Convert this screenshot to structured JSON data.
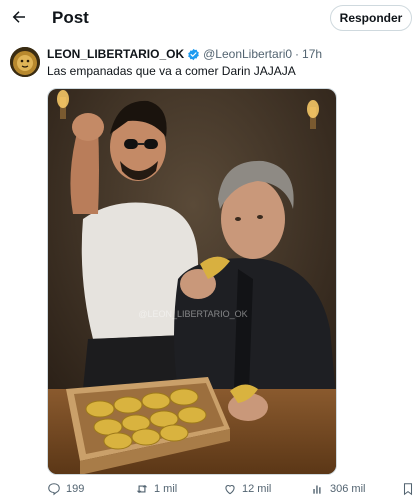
{
  "header": {
    "back_icon": "arrow-left-icon",
    "title": "Post",
    "reply_label": "Responder"
  },
  "tweet": {
    "display_name": "LEON_LIBERTARIO_OK",
    "verified_icon": "verified-badge-icon",
    "handle": "@LeonLibertari0",
    "separator": "·",
    "time": "17h",
    "text": "Las empanadas que va a comer Darin JAJAJA",
    "media_watermark": "@LEON_LIBERTARIO_OK"
  },
  "actions": {
    "replies": "199",
    "retweets": "1 mil",
    "likes": "12 mil",
    "views": "306 mil"
  },
  "colors": {
    "text_primary": "#0f1419",
    "text_secondary": "#536471",
    "border": "#cfd9de",
    "verified": "#1d9bf0"
  }
}
